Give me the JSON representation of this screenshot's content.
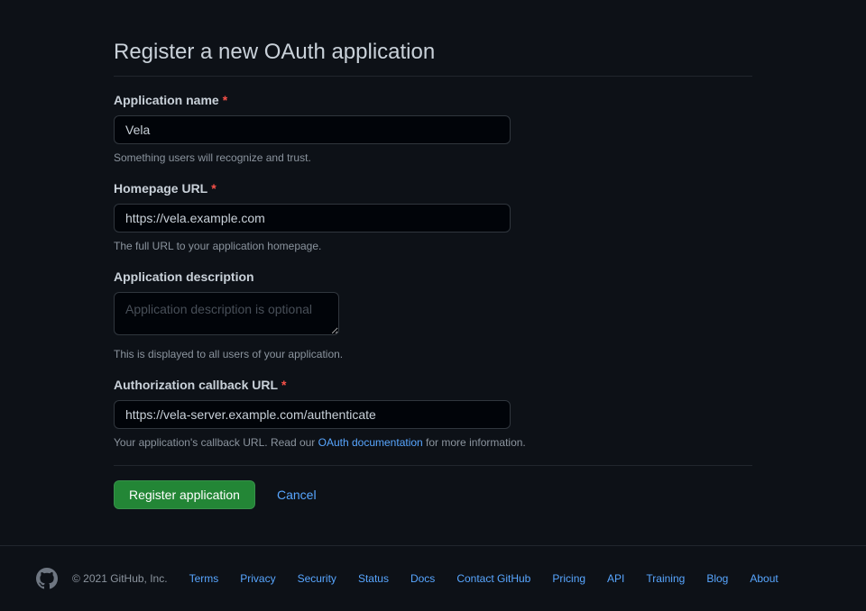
{
  "page": {
    "title": "Register a new OAuth application"
  },
  "form": {
    "app_name": {
      "label": "Application name",
      "value": "Vela",
      "hint": "Something users will recognize and trust."
    },
    "homepage_url": {
      "label": "Homepage URL",
      "value": "https://vela.example.com",
      "hint": "The full URL to your application homepage."
    },
    "description": {
      "label": "Application description",
      "placeholder": "Application description is optional",
      "hint": "This is displayed to all users of your application."
    },
    "callback_url": {
      "label": "Authorization callback URL",
      "value": "https://vela-server.example.com/authenticate",
      "hint_prefix": "Your application's callback URL. Read our ",
      "hint_link": "OAuth documentation",
      "hint_suffix": " for more information."
    },
    "submit_label": "Register application",
    "cancel_label": "Cancel"
  },
  "footer": {
    "copyright": "© 2021 GitHub, Inc.",
    "links": [
      "Terms",
      "Privacy",
      "Security",
      "Status",
      "Docs",
      "Contact GitHub",
      "Pricing",
      "API",
      "Training",
      "Blog",
      "About"
    ]
  }
}
